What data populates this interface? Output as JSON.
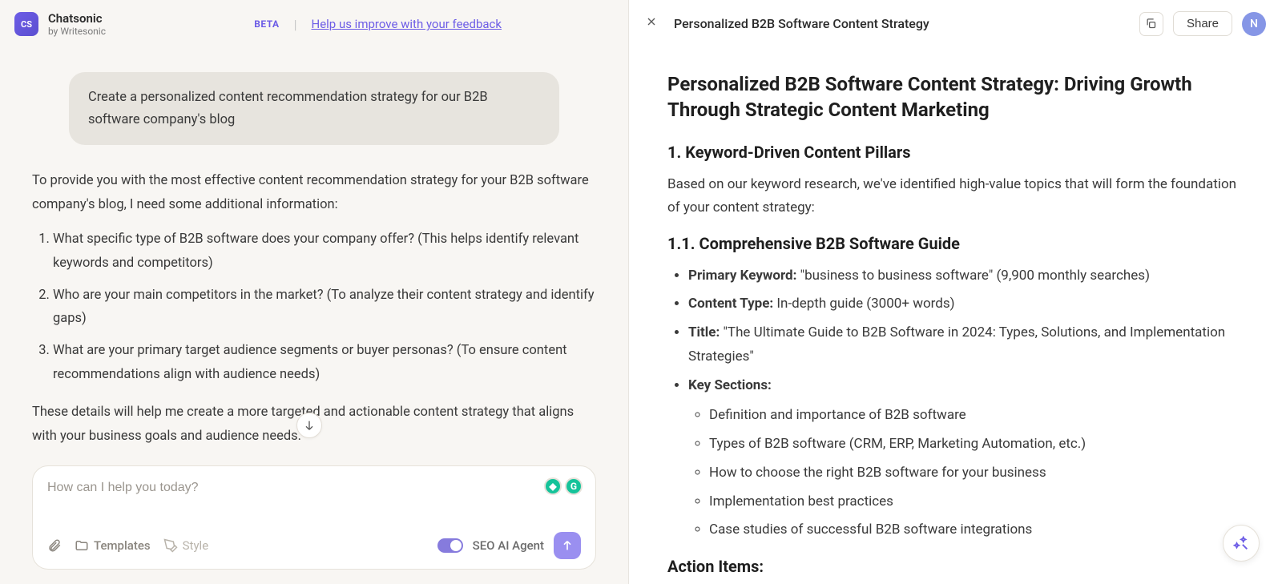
{
  "app": {
    "logo_initials": "CS",
    "title": "Chatsonic",
    "subtitle": "by Writesonic",
    "beta_badge": "BETA",
    "feedback_link": "Help us improve with your feedback"
  },
  "chat": {
    "user_prompt": "Create a personalized content recommendation strategy for our B2B software company's blog",
    "assistant_intro": "To provide you with the most effective content recommendation strategy for your B2B software company's blog, I need some additional information:",
    "assistant_q1": "What specific type of B2B software does your company offer? (This helps identify relevant keywords and competitors)",
    "assistant_q2": "Who are your main competitors in the market? (To analyze their content strategy and identify gaps)",
    "assistant_q3": "What are your primary target audience segments or buyer personas? (To ensure content recommendations align with audience needs)",
    "assistant_outro": "These details will help me create a more targeted and actionable content strategy that aligns with your business goals and audience needs."
  },
  "composer": {
    "placeholder": "How can I help you today?",
    "templates_label": "Templates",
    "style_label": "Style",
    "seo_agent_label": "SEO AI Agent"
  },
  "doc": {
    "short_title": "Personalized B2B Software Content Strategy",
    "share_label": "Share",
    "avatar_letter": "N",
    "h1": "Personalized B2B Software Content Strategy: Driving Growth Through Strategic Content Marketing",
    "h2_1": "1. Keyword-Driven Content Pillars",
    "p1": "Based on our keyword research, we've identified high-value topics that will form the foundation of your content strategy:",
    "h3_11": "1.1. Comprehensive B2B Software Guide",
    "li_primary_label": "Primary Keyword:",
    "li_primary_value": " \"business to business software\" (9,900 monthly searches)",
    "li_content_label": "Content Type:",
    "li_content_value": " In-depth guide (3000+ words)",
    "li_title_label": "Title:",
    "li_title_value": " \"The Ultimate Guide to B2B Software in 2024: Types, Solutions, and Implementation Strategies\"",
    "li_key_sections": "Key Sections:",
    "sub1": "Definition and importance of B2B software",
    "sub2": "Types of B2B software (CRM, ERP, Marketing Automation, etc.)",
    "sub3": "How to choose the right B2B software for your business",
    "sub4": "Implementation best practices",
    "sub5": "Case studies of successful B2B software integrations",
    "action_items": "Action Items:"
  }
}
